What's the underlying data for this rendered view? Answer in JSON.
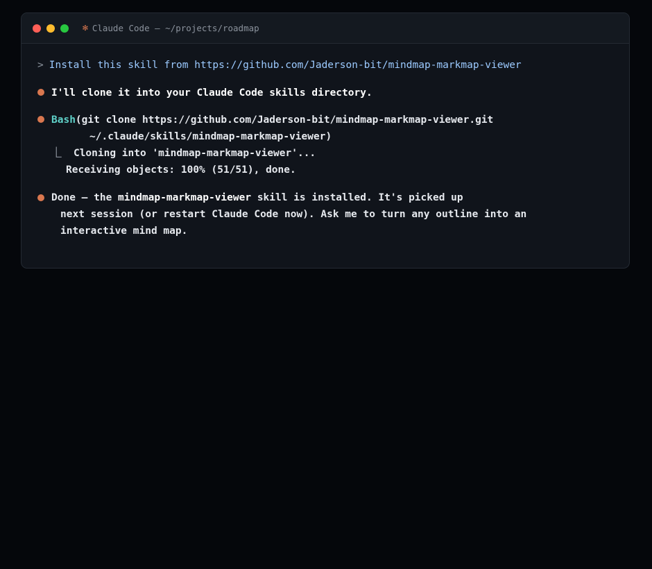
{
  "window": {
    "title": "Claude Code — ~/projects/roadmap",
    "title_icon": "asterisk-icon"
  },
  "colors": {
    "background": "#05070b",
    "panel": "#10141b",
    "accent_orange": "#d9774f",
    "prompt_blue": "#9ccaff",
    "tool_teal": "#5fd0c8"
  },
  "conversation": {
    "prompt_symbol": ">",
    "user_message": "Install this skill from https://github.com/Jaderson-bit/mindmap-markmap-viewer",
    "assistant_reply_1": "I'll clone it into your Claude Code skills directory.",
    "tool_call": {
      "name": "Bash",
      "args_line1": "(git clone https://github.com/Jaderson-bit/mindmap-markmap-viewer.git",
      "args_line2": "~/.claude/skills/mindmap-markmap-viewer)",
      "output_symbol": "⎿",
      "output_line1": "Cloning into 'mindmap-markmap-viewer'...",
      "output_line2": "Receiving objects: 100% (51/51), done."
    },
    "assistant_reply_2": {
      "prefix": "Done — the ",
      "skill_name": "mindmap-markmap-viewer",
      "suffix": " skill is installed. It's picked up",
      "line2": "next session (or restart Claude Code now). Ask me to turn any outline into an",
      "line3": "interactive mind map."
    }
  }
}
